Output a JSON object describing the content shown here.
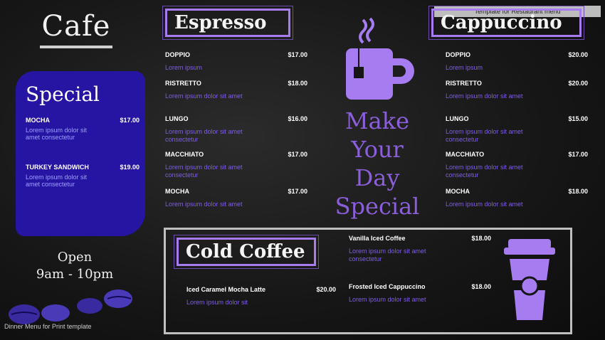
{
  "brand": {
    "name": "Cafe"
  },
  "special": {
    "title": "Special",
    "items": [
      {
        "name": "MOCHA",
        "price": "$17.00",
        "desc": "Lorem ipsum dolor sit amet consectetur"
      },
      {
        "name": "TURKEY SANDWICH",
        "price": "$19.00",
        "desc": "Lorem ipsum dolor sit amet consectetur"
      }
    ]
  },
  "hours": {
    "line1": "Open",
    "line2": "9am - 10pm"
  },
  "footer": "Dinner Menu for Print template",
  "espresso": {
    "title": "Espresso",
    "items": [
      {
        "name": "DOPPIO",
        "price": "$17.00",
        "desc": "Lorem ipsum"
      },
      {
        "name": "RISTRETTO",
        "price": "$18.00",
        "desc": "Lorem ipsum dolor sit amet"
      },
      {
        "name": "LUNGO",
        "price": "$16.00",
        "desc": "Lorem ipsum dolor sit amet consectetur"
      },
      {
        "name": "MACCHIATO",
        "price": "$17.00",
        "desc": "Lorem ipsum dolor sit amet consectetur"
      },
      {
        "name": "MOCHA",
        "price": "$17.00",
        "desc": "Lorem ipsum dolor sit amet"
      }
    ]
  },
  "cappuccino": {
    "title": "Cappuccino",
    "tag": "Template for Restaurant menu",
    "items": [
      {
        "name": "DOPPIO",
        "price": "$20.00",
        "desc": "Lorem ipsum"
      },
      {
        "name": "RISTRETTO",
        "price": "$20.00",
        "desc": "Lorem ipsum dolor sit amet"
      },
      {
        "name": "LUNGO",
        "price": "$15.00",
        "desc": "Lorem ipsum dolor sit amet consectetur"
      },
      {
        "name": "MACCHIATO",
        "price": "$17.00",
        "desc": "Lorem ipsum dolor sit amet consectetur"
      },
      {
        "name": "MOCHA",
        "price": "$18.00",
        "desc": "Lorem ipsum dolor sit amet"
      }
    ]
  },
  "tagline": {
    "w1": "Make",
    "w2": "Your",
    "w3": "Day",
    "w4": "Special"
  },
  "cold": {
    "title": "Cold Coffee",
    "items": [
      {
        "name": "Iced Caramel Mocha Latte",
        "price": "$20.00",
        "desc": "Lorem ipsum dolor sit"
      },
      {
        "name": "Vanilla Iced Coffee",
        "price": "$18.00",
        "desc": "Lorem ipsum dolor sit amet consectetur"
      },
      {
        "name": "Frosted Iced Cappuccino",
        "price": "$18.00",
        "desc": "Lorem ipsum dolor sit amet"
      }
    ]
  },
  "colors": {
    "accent": "#8b5fdb",
    "special_bg": "#2614a3",
    "background": "#161616"
  }
}
